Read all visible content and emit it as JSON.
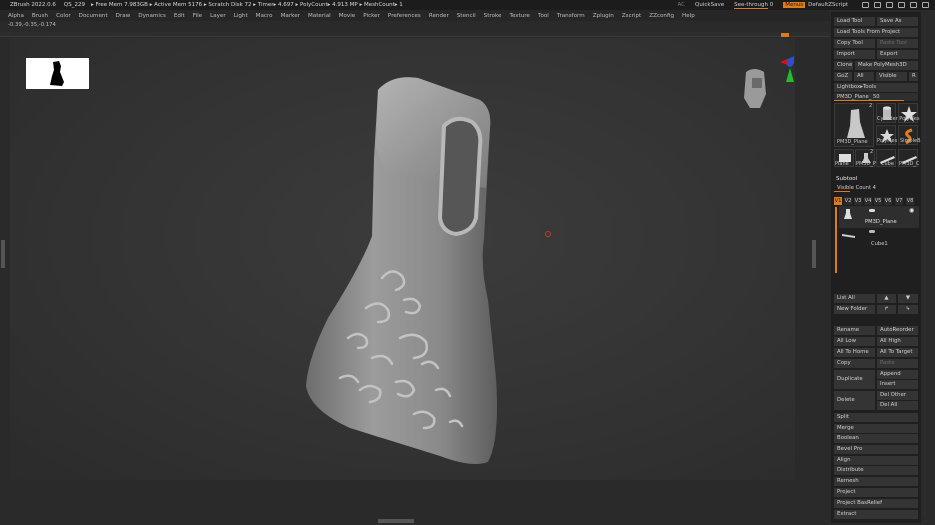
{
  "titlebar": {
    "app": "ZBrush 2022.0.6",
    "file": "QS_229",
    "stats": "▸ Free Mem 7.983GB ▸ Active Mem 5176 ▸ Scratch Disk 72 ▸ Timer▸ 4.697 ▸ PolyCount▸ 4.913 MP ▸ MeshCount▸ 1",
    "ac": "AC",
    "quicksave": "QuickSave",
    "see_through": "See-through  0",
    "menus": "Menus",
    "default_script": "DefaultZScript"
  },
  "menubar": {
    "items": [
      "Alpha",
      "Brush",
      "Color",
      "Document",
      "Draw",
      "Dynamics",
      "Edit",
      "File",
      "Layer",
      "Light",
      "Macro",
      "Marker",
      "Material",
      "Movie",
      "Picker",
      "Preferences",
      "Render",
      "Stencil",
      "Stroke",
      "Texture",
      "Tool",
      "Transform",
      "Zplugin",
      "Zscript",
      "ZZconfig",
      "Help"
    ]
  },
  "canvas": {
    "coords": "-0.39,-0.35,-0.174"
  },
  "panel": {
    "load_tool": "Load Tool",
    "save_as": "Save As",
    "load_from_project": "Load Tools From Project",
    "copy_tool": "Copy Tool",
    "paste_tool": "Paste Tool",
    "import": "Import",
    "export": "Export",
    "clone": "Clone",
    "make_polymesh": "Make PolyMesh3D",
    "goz": "GoZ",
    "all": "All",
    "visible": "Visible",
    "r": "R",
    "lightbox_tools": "Lightbox▸Tools",
    "pm3d_slider": "PM3D_Plane_ 50",
    "tools": {
      "main_label": "PM3D_Plane",
      "main_count": "2",
      "cylinder_polymesh": "Cylinder PolyMes",
      "polymesh": "PolyMes",
      "simpleb": "SimpleB",
      "plane": "Plane",
      "pm3d_p": "PM3D_P",
      "pm3d_p_count": "2",
      "cube": "Cube",
      "pm3d_c": "PM3D_C"
    },
    "subtool_header": "Subtool",
    "visible_count": "Visible Count 4",
    "vtabs": [
      "V1",
      "V2",
      "V3",
      "V4",
      "V5",
      "V6",
      "V7",
      "V8"
    ],
    "subtool_items": [
      "PM3D_Plane",
      "Cube1"
    ],
    "list_all": "List All",
    "new_folder": "New Folder",
    "rename": "Rename",
    "auto_reorder": "AutoReorder",
    "all_low": "All Low",
    "all_high": "All High",
    "all_to_home": "All To Home",
    "all_to_target": "All To Target",
    "copy": "Copy",
    "paste": "Paste",
    "duplicate": "Duplicate",
    "append": "Append",
    "insert": "Insert",
    "delete": "Delete",
    "del_other": "Del Other",
    "del_all": "Del All",
    "split": "Split",
    "merge": "Merge",
    "boolean": "Boolean",
    "bevel_pro": "Bevel Pro",
    "align": "Align",
    "distribute": "Distribute",
    "remesh": "Remesh",
    "project": "Project",
    "project_basrelief": "Project BasRelief",
    "extract": "Extract"
  }
}
